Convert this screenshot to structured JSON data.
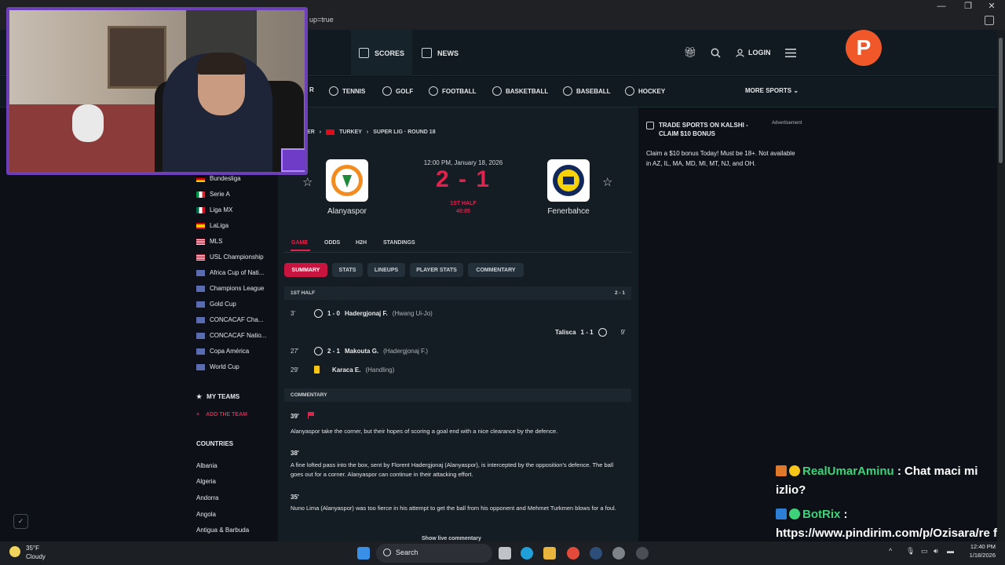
{
  "browser": {
    "url_fragment": "up=true",
    "window_controls": [
      "—",
      "❐",
      "✕"
    ]
  },
  "header": {
    "tabs": [
      {
        "label": "SCORES",
        "icon": "scoreboard-icon",
        "active": true
      },
      {
        "label": "NEWS",
        "icon": "newspaper-icon",
        "active": false
      }
    ],
    "login_label": "LOGIN",
    "logo_letter": "P"
  },
  "sports": {
    "partial_first": "R",
    "items": [
      "TENNIS",
      "GOLF",
      "FOOTBALL",
      "BASKETBALL",
      "BASEBALL",
      "HOCKEY"
    ],
    "more_label": "MORE SPORTS"
  },
  "sidebar": {
    "leagues": [
      {
        "label": "Bundesliga",
        "flag": "germany"
      },
      {
        "label": "Serie A",
        "flag": "italy"
      },
      {
        "label": "Liga MX",
        "flag": "mexico"
      },
      {
        "label": "LaLiga",
        "flag": "spain"
      },
      {
        "label": "MLS",
        "flag": "usa"
      },
      {
        "label": "USL Championship",
        "flag": "usa"
      },
      {
        "label": "Africa Cup of Nati...",
        "flag": "world"
      },
      {
        "label": "Champions League",
        "flag": "world"
      },
      {
        "label": "Gold Cup",
        "flag": "world"
      },
      {
        "label": "CONCACAF Cha...",
        "flag": "world"
      },
      {
        "label": "CONCACAF Natio...",
        "flag": "world"
      },
      {
        "label": "Copa América",
        "flag": "world"
      },
      {
        "label": "World Cup",
        "flag": "world"
      }
    ],
    "my_teams_label": "MY TEAMS",
    "add_team_label": "ADD THE TEAM",
    "countries_label": "COUNTRIES",
    "countries": [
      "Albania",
      "Algeria",
      "Andorra",
      "Angola",
      "Antigua & Barbuda"
    ]
  },
  "match": {
    "breadcrumb": {
      "sport": "CER",
      "country": "TURKEY",
      "competition": "SUPER LIG · ROUND 18"
    },
    "kickoff": "12:00 PM, January 18, 2026",
    "score": "2 - 1",
    "period": "1ST HALF",
    "clock": "40:05",
    "home": "Alanyaspor",
    "away": "Fenerbahce",
    "tabs": [
      "GAME",
      "ODDS",
      "H2H",
      "STANDINGS"
    ],
    "subtabs": [
      "SUMMARY",
      "STATS",
      "LINEUPS",
      "PLAYER STATS",
      "COMMENTARY"
    ],
    "half_header": "1ST HALF",
    "half_score": "2 - 1",
    "events": [
      {
        "min": "3'",
        "score": "1 - 0",
        "player": "Hadergjonaj F.",
        "assist": "(Hwang Ui-Jo)"
      },
      {
        "min": "9'",
        "score": "1 - 1",
        "player": "Talisca"
      },
      {
        "min": "27'",
        "score": "2 - 1",
        "player": "Makouta G.",
        "assist": "(Hadergjonaj F.)"
      },
      {
        "min": "29'",
        "player": "Karaca E.",
        "assist": "(Handling)"
      }
    ],
    "commentary_header": "COMMENTARY",
    "commentary": [
      {
        "min": "39'",
        "text": "Alanyaspor take the corner, but their hopes of scoring a goal end with a nice clearance by the defence."
      },
      {
        "min": "38'",
        "text": "A fine lofted pass into the box, sent by Florent Hadergjonaj (Alanyaspor), is intercepted by the opposition's defence. The ball goes out for a corner. Alanyaspor can continue in their attacking effort."
      },
      {
        "min": "35'",
        "text": "Nuno Lima (Alanyaspor) was too fierce in his attempt to get the ball from his opponent and Mehmet Turkmen blows for a foul."
      }
    ],
    "show_live": "Show live commentary"
  },
  "ad": {
    "title": "TRADE SPORTS ON KALSHI - CLAIM $10 BONUS",
    "label": "Advertisement",
    "body": "Claim a $10 bonus Today! Must be 18+. Not available in AZ, IL, MA, MD, MI, MT, NJ, and OH."
  },
  "chat": [
    {
      "user": "RealUmarAminu",
      "message": ": Chat maci mi izlio?"
    },
    {
      "user": "BotRix",
      "message": ": https://www.pindirim.com/p/Ozisara/re f"
    }
  ],
  "taskbar": {
    "temp": "35°F",
    "condition": "Cloudy",
    "search_label": "Search",
    "time": "12:40 PM",
    "date": "1/18/2026"
  }
}
